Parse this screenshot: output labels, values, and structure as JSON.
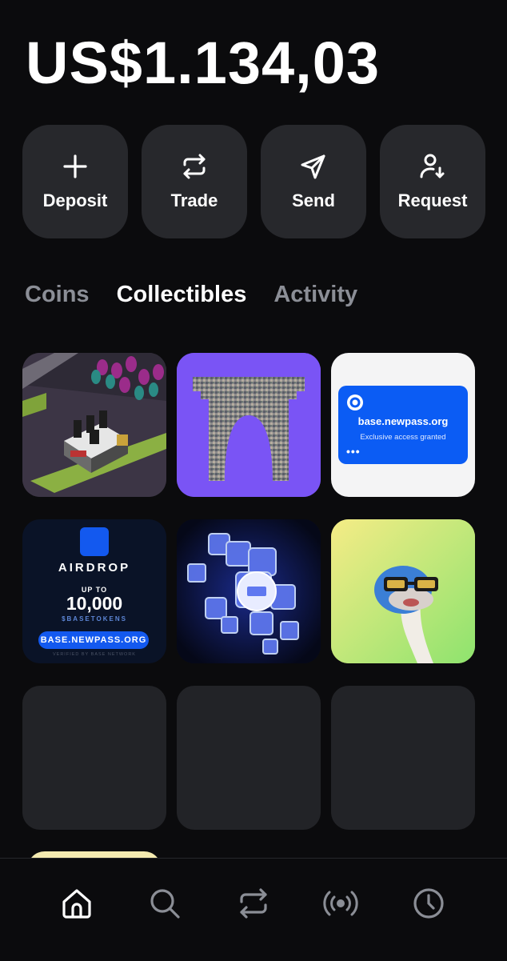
{
  "balance": "US$1.134,03",
  "actions": [
    {
      "label": "Deposit",
      "icon": "plus-icon"
    },
    {
      "label": "Trade",
      "icon": "swap-icon"
    },
    {
      "label": "Send",
      "icon": "send-icon"
    },
    {
      "label": "Request",
      "icon": "user-receive-icon"
    }
  ],
  "tabs": [
    {
      "label": "Coins",
      "active": false
    },
    {
      "label": "Collectibles",
      "active": true
    },
    {
      "label": "Activity",
      "active": false
    }
  ],
  "collectibles": {
    "newpass": {
      "title": "base.newpass.org",
      "subtitle": "Exclusive access granted",
      "dots": "•••"
    },
    "airdrop": {
      "title": "AIRDROP",
      "up_to": "UP TO",
      "amount": "10,000",
      "token": "$BASETOKENS",
      "button": "BASE.NEWPASS.ORG",
      "verified": "VERIFIED BY BASE NETWORK"
    }
  },
  "nav": [
    {
      "icon": "home-icon",
      "active": true
    },
    {
      "icon": "search-icon",
      "active": false
    },
    {
      "icon": "swap-icon",
      "active": false
    },
    {
      "icon": "broadcast-icon",
      "active": false
    },
    {
      "icon": "clock-icon",
      "active": false
    }
  ],
  "colors": {
    "background": "#0b0b0d",
    "card": "#27282c",
    "accent_blue": "#0b5cf4",
    "purple": "#7a54f5",
    "muted_text": "#8b8e96"
  }
}
